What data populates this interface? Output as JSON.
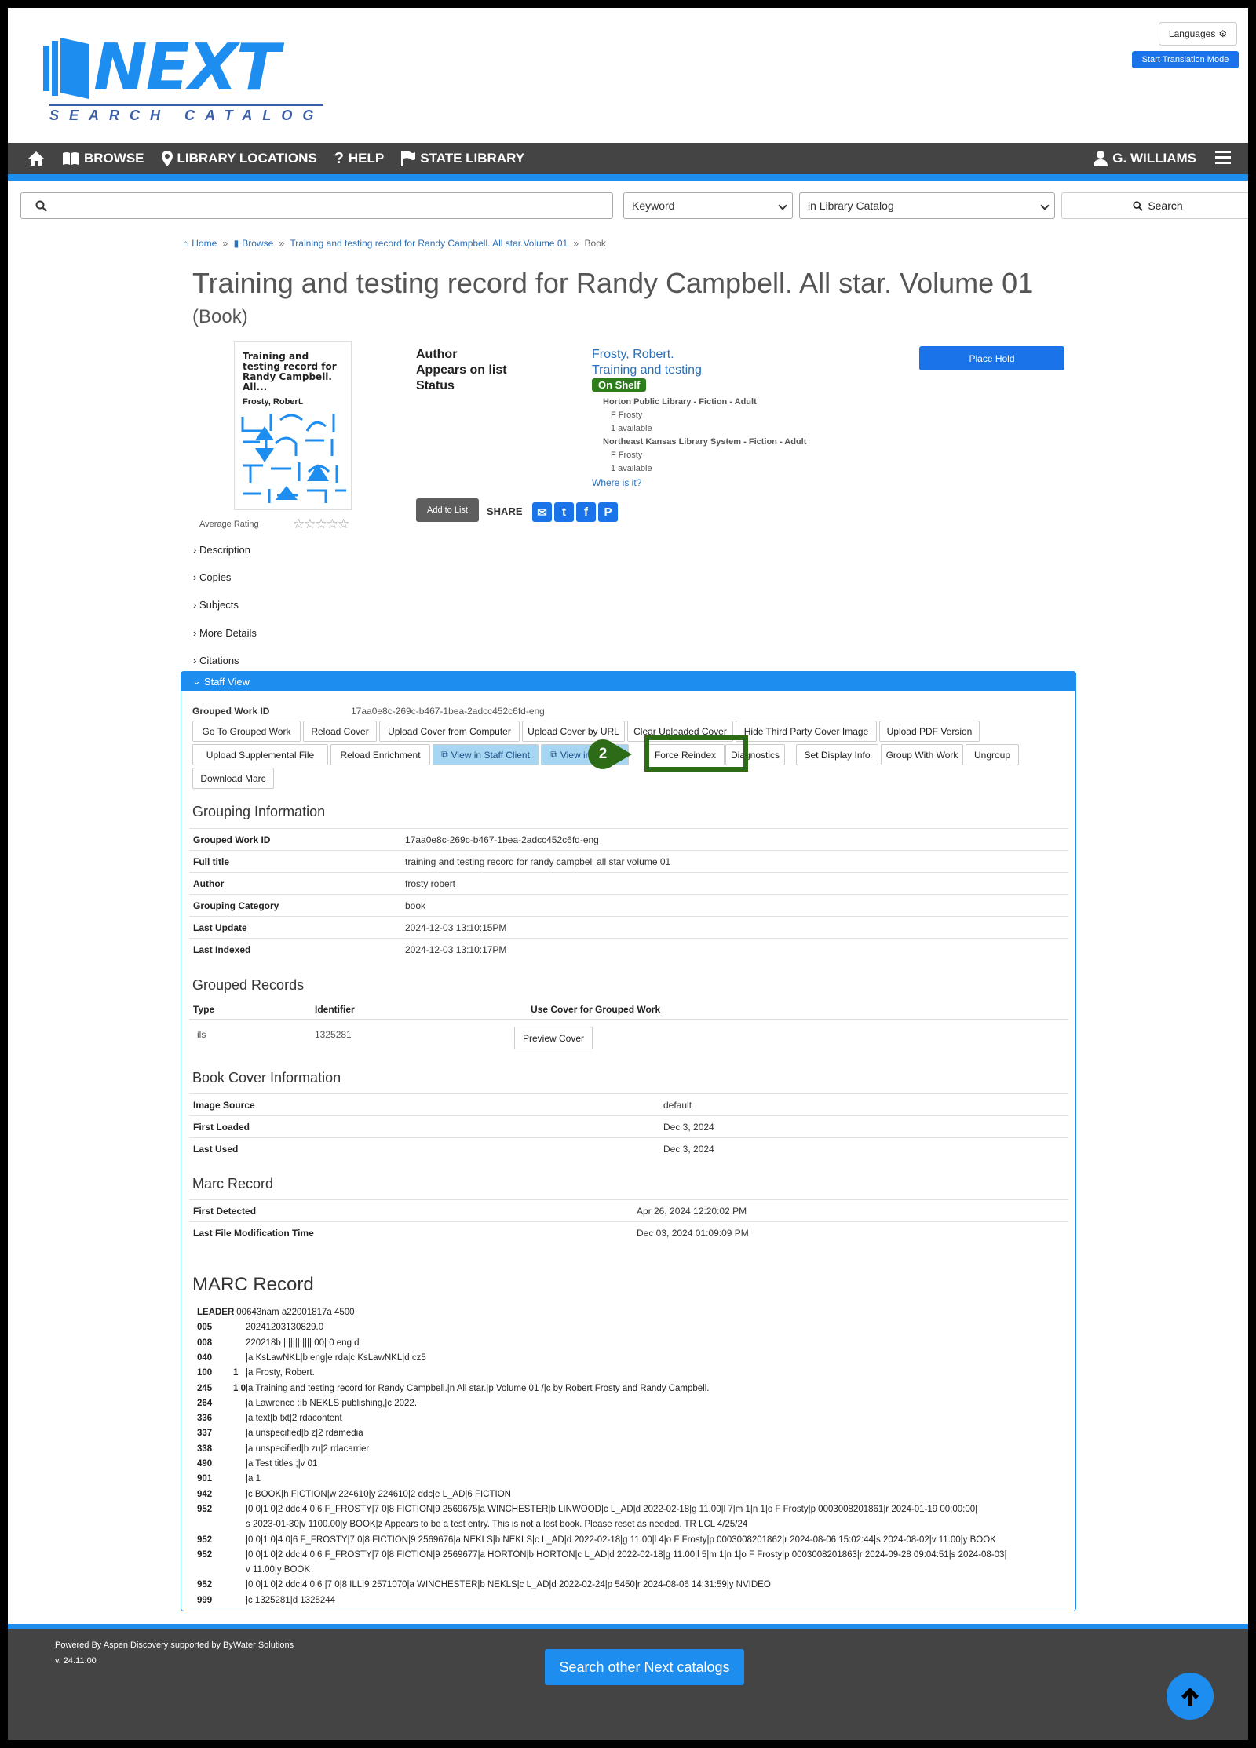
{
  "header": {
    "logo_word": "NEXT",
    "logo_sub": "SEARCH CATALOG",
    "languages_label": "Languages",
    "translation_label": "Start Translation Mode"
  },
  "nav": {
    "browse": "BROWSE",
    "locations": "LIBRARY LOCATIONS",
    "help": "HELP",
    "state_library": "STATE LIBRARY",
    "user": "G. WILLIAMS"
  },
  "search": {
    "value": "",
    "type_selected": "Keyword",
    "scope_selected": "in Library Catalog",
    "button": "Search"
  },
  "breadcrumb": {
    "home": "Home",
    "browse": "Browse",
    "record": "Training and testing record for Randy Campbell. All star.Volume 01",
    "current": "Book",
    "sep": "»"
  },
  "record": {
    "title": "Training and testing record for Randy Campbell. All star. Volume 01",
    "format": "(Book)",
    "cover_title": "Training and testing record for Randy Campbell. All...",
    "cover_author": "Frosty, Robert.",
    "avg_rating_label": "Average Rating",
    "stars": "☆☆☆☆☆",
    "author_label": "Author",
    "author": "Frosty, Robert.",
    "list_label": "Appears on list",
    "list": "Training and testing",
    "status_label": "Status",
    "status": "On Shelf",
    "holdings": [
      {
        "location": "Horton Public Library - Fiction - Adult",
        "call": "F Frosty",
        "avail": "1 available"
      },
      {
        "location": "Northeast Kansas Library System - Fiction - Adult",
        "call": "F Frosty",
        "avail": "1 available"
      }
    ],
    "where_is_it": "Where is it?",
    "place_hold": "Place Hold",
    "add_to_list": "Add to List",
    "share": "SHARE"
  },
  "accordion": [
    "Description",
    "Copies",
    "Subjects",
    "More Details",
    "Citations"
  ],
  "staff": {
    "header": "Staff View",
    "gw_label": "Grouped Work ID",
    "gw_value": "17aa0e8c-269c-b467-1bea-2adcc452c6fd-eng",
    "buttons_row1": [
      "Go To Grouped Work",
      "Reload Cover",
      "Upload Cover from Computer",
      "Upload Cover by URL",
      "Clear Uploaded Cover",
      "Hide Third Party Cover Image",
      "Upload PDF Version"
    ],
    "buttons_row2": [
      "Upload Supplemental File",
      "Reload Enrichment",
      "View in Staff Client",
      "View in OPAC",
      "Force Reindex",
      "Diagnostics",
      "Set Display Info",
      "Group With Work",
      "Ungroup"
    ],
    "buttons_row3": [
      "Download Marc"
    ],
    "callout_number": "2",
    "grouping_title": "Grouping Information",
    "grouping": [
      {
        "k": "Grouped Work ID",
        "v": "17aa0e8c-269c-b467-1bea-2adcc452c6fd-eng"
      },
      {
        "k": "Full title",
        "v": "training and testing record for randy campbell all star volume 01"
      },
      {
        "k": "Author",
        "v": "frosty robert"
      },
      {
        "k": "Grouping Category",
        "v": "book"
      },
      {
        "k": "Last Update",
        "v": "2024-12-03 13:10:15PM"
      },
      {
        "k": "Last Indexed",
        "v": "2024-12-03 13:10:17PM"
      }
    ],
    "grouped_records_title": "Grouped Records",
    "gr_headers": [
      "Type",
      "Identifier",
      "Use Cover for Grouped Work"
    ],
    "gr_row": {
      "type": "ils",
      "id": "1325281",
      "btn": "Preview Cover"
    },
    "cover_info_title": "Book Cover Information",
    "cover_info": [
      {
        "k": "Image Source",
        "v": "default"
      },
      {
        "k": "First Loaded",
        "v": "Dec 3, 2024"
      },
      {
        "k": "Last Used",
        "v": "Dec 3, 2024"
      }
    ],
    "marc_record_title": "Marc Record",
    "marc_info": [
      {
        "k": "First Detected",
        "v": "Apr 26, 2024 12:20:02 PM"
      },
      {
        "k": "Last File Modification Time",
        "v": "Dec 03, 2024 01:09:09 PM"
      }
    ],
    "marc_big_title": "MARC Record",
    "marc": [
      {
        "tag": "LEADER",
        "ind": "",
        "text": "00643nam a22001817a 4500"
      },
      {
        "tag": "005",
        "ind": "",
        "text": "20241203130829.0"
      },
      {
        "tag": "008",
        "ind": "",
        "text": "220218b        ||||||| |||| 00| 0 eng d"
      },
      {
        "tag": "040",
        "ind": "",
        "text": "|a KsLawNKL|b eng|e rda|c KsLawNKL|d cz5"
      },
      {
        "tag": "100",
        "ind": "1",
        "text": "|a Frosty, Robert."
      },
      {
        "tag": "245",
        "ind": "1 0",
        "text": "|a Training and testing record for Randy Campbell.|n All star.|p Volume 01 /|c by Robert Frosty and Randy Campbell."
      },
      {
        "tag": "264",
        "ind": "",
        "text": "|a Lawrence :|b NEKLS publishing,|c 2022."
      },
      {
        "tag": "336",
        "ind": "",
        "text": "|a text|b txt|2 rdacontent"
      },
      {
        "tag": "337",
        "ind": "",
        "text": "|a unspecified|b z|2 rdamedia"
      },
      {
        "tag": "338",
        "ind": "",
        "text": "|a unspecified|b zu|2 rdacarrier"
      },
      {
        "tag": "490",
        "ind": "",
        "text": "|a Test titles ;|v 01"
      },
      {
        "tag": "901",
        "ind": "",
        "text": "|a 1"
      },
      {
        "tag": "942",
        "ind": "",
        "text": "|c BOOK|h FICTION|w 224610|y 224610|2 ddc|e L_AD|6 FICTION"
      },
      {
        "tag": "952",
        "ind": "",
        "text": "|0 0|1 0|2 ddc|4 0|6 F_FROSTY|7 0|8 FICTION|9 2569675|a WINCHESTER|b LINWOOD|c L_AD|d 2022-02-18|g 11.00|l 7|m 1|n 1|o F Frosty|p 0003008201861|r 2024-01-19 00:00:00|",
        "text2": "s 2023-01-30|v 1100.00|y BOOK|z Appears to be a test entry. This is not a lost book. Please reset as needed. TR LCL 4/25/24"
      },
      {
        "tag": "952",
        "ind": "",
        "text": "|0 0|1 0|4 0|6 F_FROSTY|7 0|8 FICTION|9 2569676|a NEKLS|b NEKLS|c L_AD|d 2022-02-18|g 11.00|l 4|o F Frosty|p 0003008201862|r 2024-08-06 15:02:44|s 2024-08-02|v 11.00|y BOOK"
      },
      {
        "tag": "952",
        "ind": "",
        "text": "|0 0|1 0|2 ddc|4 0|6 F_FROSTY|7 0|8 FICTION|9 2569677|a HORTON|b HORTON|c L_AD|d 2022-02-18|g 11.00|l 5|m 1|n 1|o F Frosty|p 0003008201863|r 2024-09-28 09:04:51|s 2024-08-03|",
        "text2": "v 11.00|y BOOK"
      },
      {
        "tag": "952",
        "ind": "",
        "text": "|0 0|1 0|2 ddc|4 0|6 |7 0|8 ILL|9 2571070|a WINCHESTER|b NEKLS|c L_AD|d 2022-02-24|p 5450|r 2024-08-06 14:31:59|y NVIDEO"
      },
      {
        "tag": "999",
        "ind": "",
        "text": "|c 1325281|d 1325244"
      }
    ]
  },
  "footer": {
    "powered": "Powered By Aspen Discovery supported by ByWater Solutions",
    "version": "v. 24.11.00",
    "other": "Search other Next catalogs"
  }
}
